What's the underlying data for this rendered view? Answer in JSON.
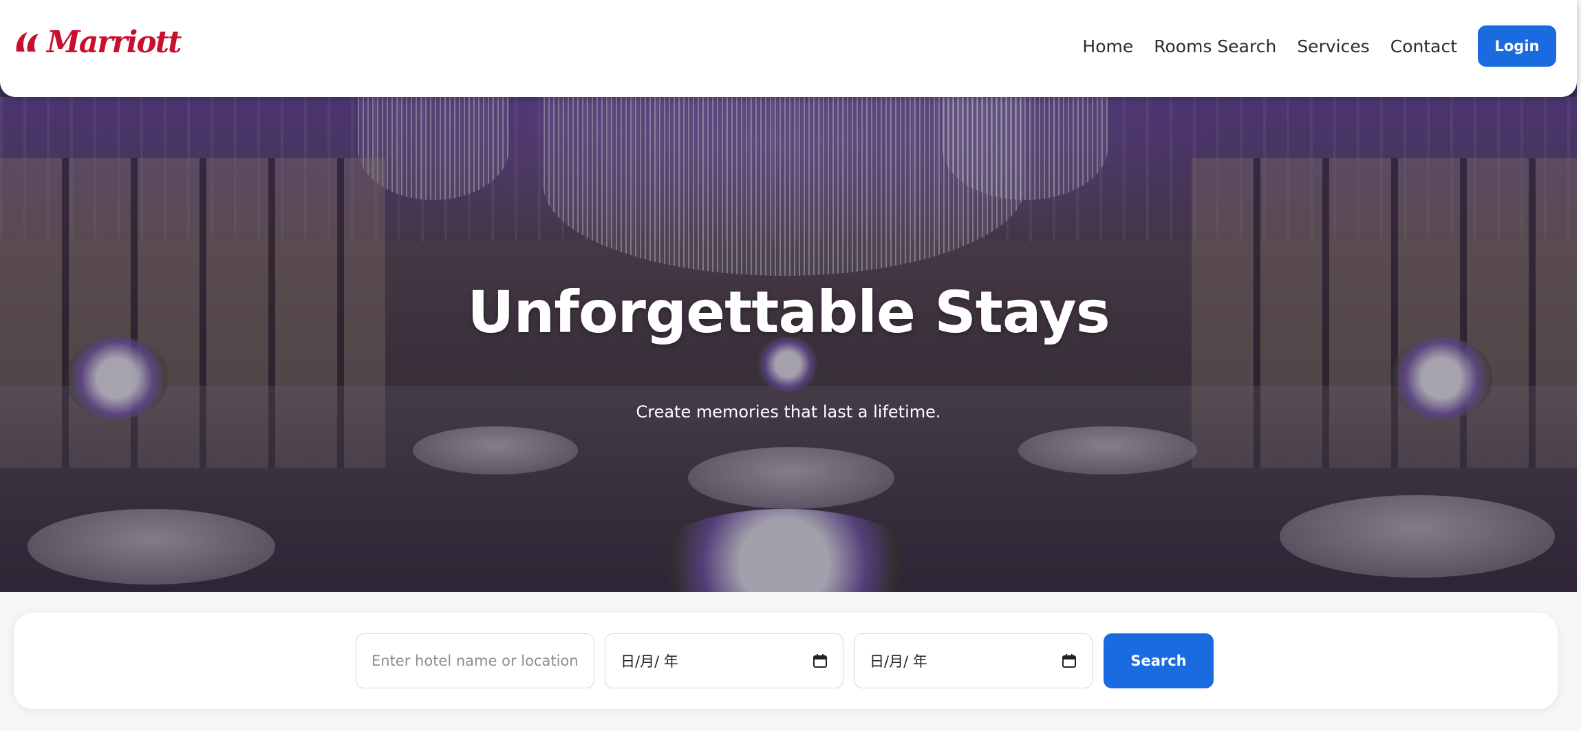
{
  "brand": {
    "name": "Marriott",
    "logo_icon": "marriott-logo-icon",
    "color": "#c8102e"
  },
  "nav": {
    "items": [
      {
        "label": "Home"
      },
      {
        "label": "Rooms Search"
      },
      {
        "label": "Services"
      },
      {
        "label": "Contact"
      }
    ],
    "login_label": "Login"
  },
  "hero": {
    "title": "Unforgettable Stays",
    "subtitle": "Create memories that last a lifetime."
  },
  "search": {
    "location_placeholder": "Enter hotel name or location",
    "location_value": "",
    "checkin_display": "日/月/ 年",
    "checkout_display": "日/月/ 年",
    "calendar_icon": "calendar-icon",
    "button_label": "Search"
  },
  "colors": {
    "accent": "#1a6be0",
    "brand_red": "#c8102e",
    "page_bg": "#f5f6f8"
  }
}
